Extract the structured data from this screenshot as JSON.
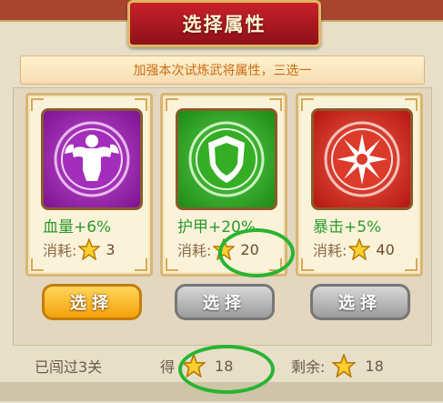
{
  "title": "选择属性",
  "notice": "加强本次试炼武将属性，三选一",
  "cards": [
    {
      "attr_label": "血量",
      "attr_value": "+6%",
      "cost_label": "消耗:",
      "cost_value": "3",
      "icon": "muscle-body-icon",
      "color": "#9b1fb0"
    },
    {
      "attr_label": "护甲",
      "attr_value": "+20%",
      "cost_label": "消耗:",
      "cost_value": "20",
      "icon": "shield-icon",
      "color": "#2fa81f"
    },
    {
      "attr_label": "暴击",
      "attr_value": "+5%",
      "cost_label": "消耗:",
      "cost_value": "40",
      "icon": "critical-burst-icon",
      "color": "#d8291f"
    }
  ],
  "buttons": [
    "选择",
    "选择",
    "选择"
  ],
  "footer": {
    "passed": "已闯过3关",
    "earn_label": "得",
    "earn_value": "18",
    "remain_label": "剩余:",
    "remain_value": "18"
  }
}
